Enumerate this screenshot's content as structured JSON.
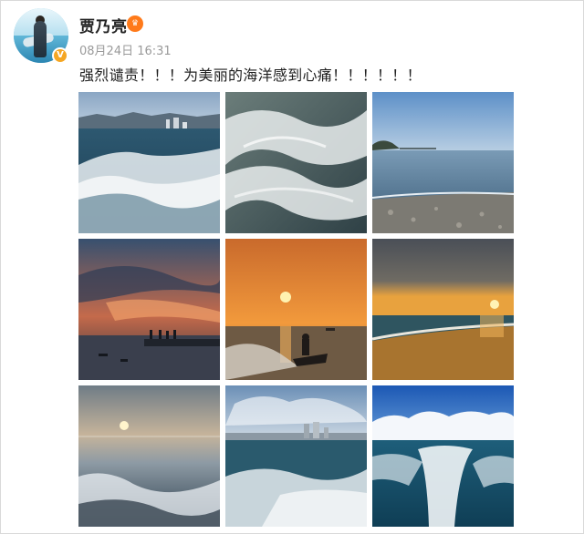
{
  "user": {
    "name": "贾乃亮",
    "avatar_icon": "avatar-photo",
    "verified_icon": "verified-badge-icon",
    "vip_icon": "emoji-badge-icon"
  },
  "post": {
    "date": "08月24日",
    "time": "16:31",
    "text": "强烈谴责！！！为美丽的海洋感到心痛！！！！！！"
  },
  "photos": [
    {
      "subject": "choppy sea with wake and distant city"
    },
    {
      "subject": "close-up crashing wave foam"
    },
    {
      "subject": "calm sea with rocky shore and island"
    },
    {
      "subject": "sunset clouds over pier silhouettes"
    },
    {
      "subject": "orange sunset with jet ski rider"
    },
    {
      "subject": "golden sunset over beach"
    },
    {
      "subject": "hazy sun over splashing sea"
    },
    {
      "subject": "cloudy sky over city skyline and waves"
    },
    {
      "subject": "blue sky with boat wake"
    }
  ],
  "colors": {
    "name": "#222222",
    "time": "#9a9a9a",
    "badge": "#f5a623"
  }
}
